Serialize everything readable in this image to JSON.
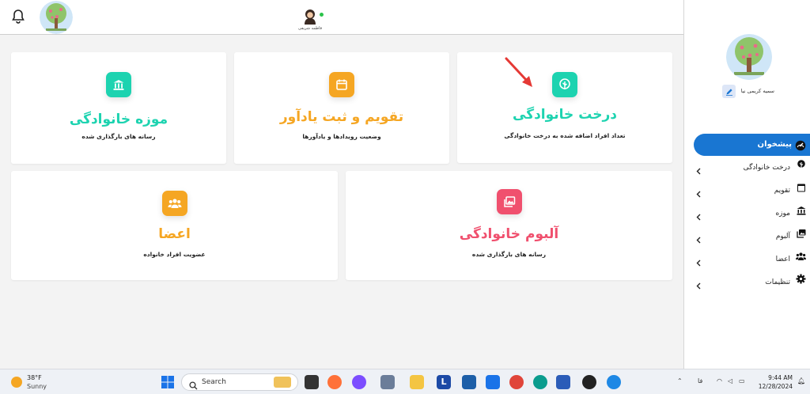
{
  "header": {
    "user_name": "فاطمه شریفی",
    "icons": [
      "bell-icon",
      "family-tree-logo",
      "user-avatar"
    ]
  },
  "cards": {
    "family_tree": {
      "title": "درخت خانوادگی",
      "subtitle": "تعداد افراد اضافه شده به درخت خانوادگی",
      "icon": "tree-icon",
      "color": "#1dd3b0"
    },
    "calendar": {
      "title": "تقویم و ثبت یادآور",
      "subtitle": "وضعیت رویدادها و یادآورها",
      "icon": "calendar-icon",
      "color": "#f5a623"
    },
    "museum": {
      "title": "موزه خانوادگی",
      "subtitle": "رسانه های بارگذاری شده",
      "icon": "museum-icon",
      "color": "#1dd3b0"
    },
    "album": {
      "title": "آلبوم خانوادگی",
      "subtitle": "رسانه های بارگذاری شده",
      "icon": "gallery-icon",
      "color": "#f0506e"
    },
    "members": {
      "title": "اعضا",
      "subtitle": "عضویت افراد خانواده",
      "icon": "group-icon",
      "color": "#f5a623"
    }
  },
  "sidebar": {
    "profile_name": "سمیه کریمی نیا",
    "active": {
      "label": "پیشخوان",
      "icon": "dashboard-icon"
    },
    "items": [
      {
        "label": "درخت خانوادگی",
        "icon": "tree-icon"
      },
      {
        "label": "تقویم",
        "icon": "calendar-icon"
      },
      {
        "label": "موزه",
        "icon": "museum-icon"
      },
      {
        "label": "آلبوم",
        "icon": "gallery-icon"
      },
      {
        "label": "اعضا",
        "icon": "group-icon"
      },
      {
        "label": "تنظیمات",
        "icon": "gear-icon"
      }
    ],
    "accent": "#1976d2"
  },
  "taskbar": {
    "temperature": "38°F",
    "condition": "Sunny",
    "search_label": "Search",
    "lang": "فا",
    "time": "9:44 AM",
    "date": "12/28/2024"
  }
}
